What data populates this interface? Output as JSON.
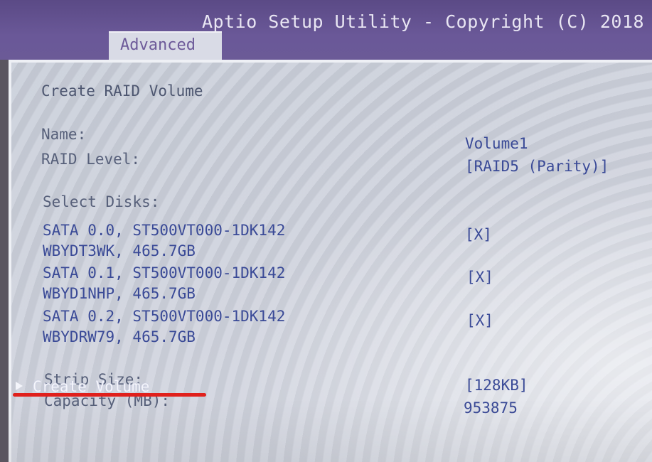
{
  "header": {
    "title": "Aptio Setup Utility - Copyright (C) 2018",
    "active_tab": "Advanced"
  },
  "form": {
    "heading": "Create RAID Volume",
    "name_label": "Name:",
    "name_value": "Volume1",
    "raid_level_label": "RAID Level:",
    "raid_level_value": "[RAID5 (Parity)]",
    "select_disks_label": "Select Disks:",
    "disks": [
      {
        "line1": "SATA 0.0, ST500VT000-1DK142",
        "line2": "WBYDT3WK, 465.7GB",
        "selected": "[X]"
      },
      {
        "line1": "SATA 0.1, ST500VT000-1DK142",
        "line2": "WBYD1NHP, 465.7GB",
        "selected": "[X]"
      },
      {
        "line1": "SATA 0.2, ST500VT000-1DK142",
        "line2": "WBYDRW79, 465.7GB",
        "selected": "[X]"
      }
    ],
    "strip_size_label": "Strip Size:",
    "strip_size_value": "[128KB]",
    "capacity_label": "Capacity (MB):",
    "capacity_value": "953875",
    "create_volume_label": "Create Volume"
  },
  "colors": {
    "header_purple": "#6b5a97",
    "field_blue": "#3a4a97",
    "highlight_white": "#f4f5fb",
    "annotation_red": "#e0201c"
  }
}
